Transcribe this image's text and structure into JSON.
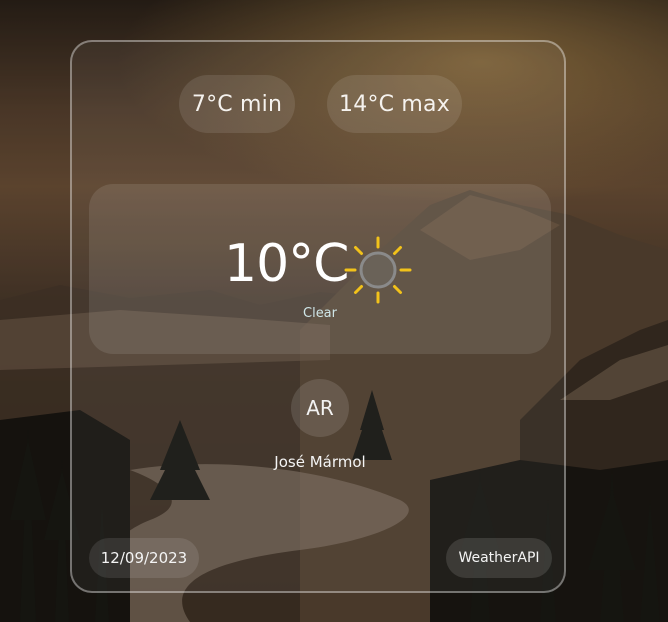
{
  "temperature": {
    "min_label": "7°C min",
    "max_label": "14°C max",
    "current": "10°C",
    "condition": "Clear"
  },
  "weather_icon": "sun-icon",
  "user": {
    "initials": "AR",
    "location": "José Mármol"
  },
  "footer": {
    "date": "12/09/2023",
    "source": "WeatherAPI"
  },
  "colors": {
    "sun_rays": "#f2c21a",
    "sun_ring": "#8a8a8a",
    "condition_text": "#cfe6e8",
    "card_border": "rgba(255,255,255,0.38)"
  }
}
